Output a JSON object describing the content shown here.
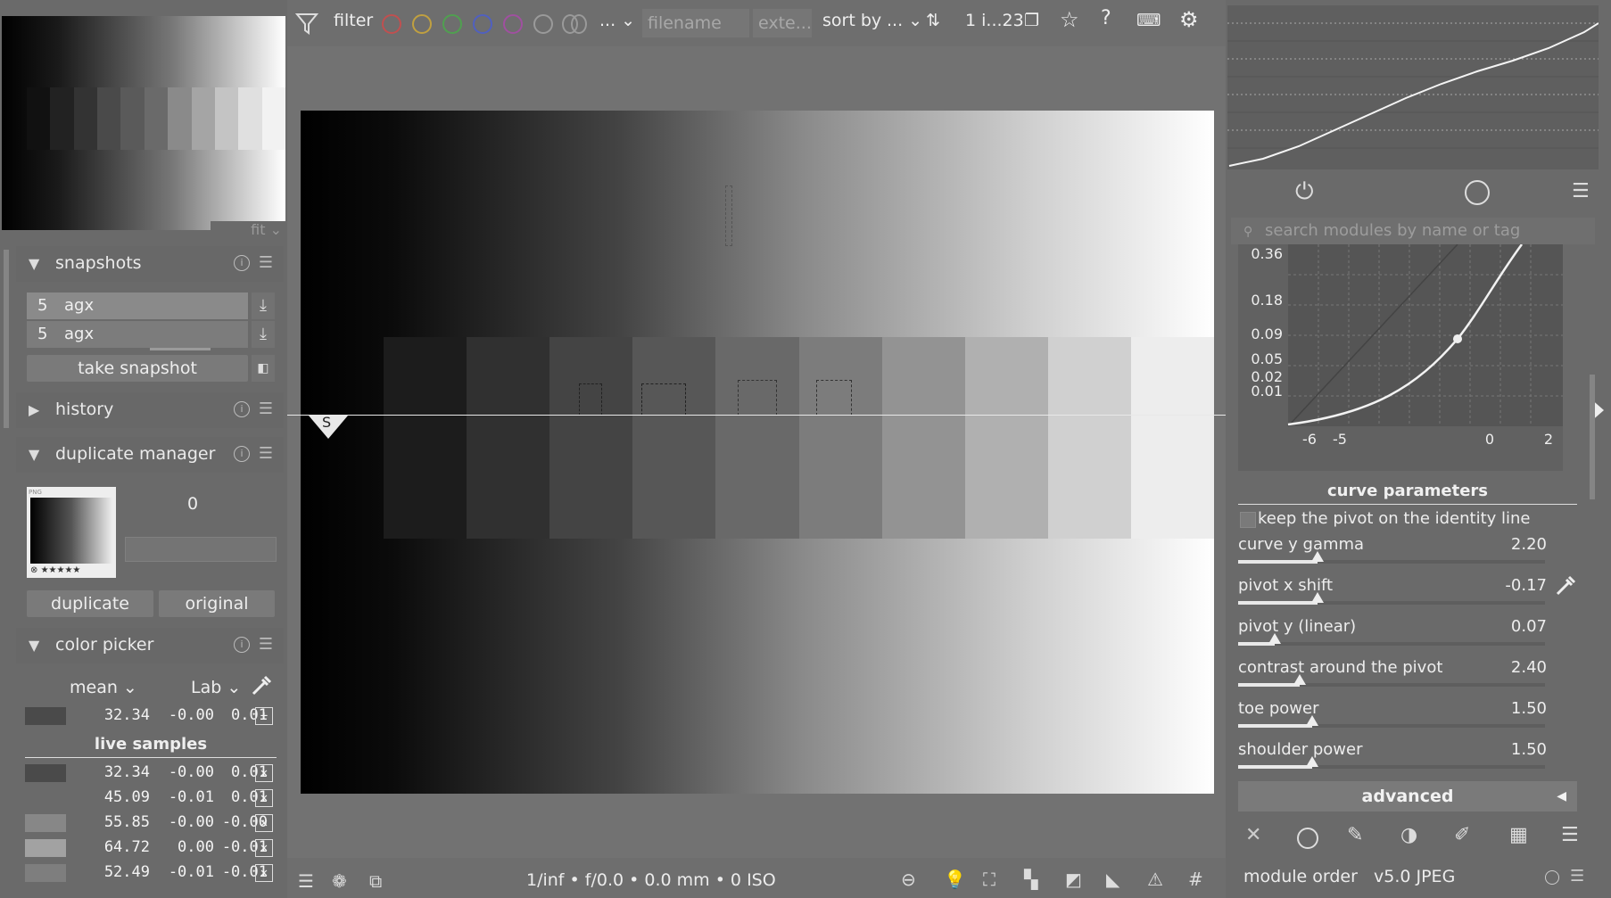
{
  "left": {
    "navigation": {
      "zoom_label": "fit"
    },
    "snapshots": {
      "title": "snapshots",
      "items": [
        {
          "number": "5",
          "label": "agx"
        },
        {
          "number": "5",
          "label": "agx"
        }
      ],
      "take_label": "take snapshot"
    },
    "history": {
      "title": "history"
    },
    "duplicate_manager": {
      "title": "duplicate manager",
      "count": "0",
      "thumb_badge": "PNG",
      "thumb_stars": "★★★★★",
      "duplicate_label": "duplicate",
      "original_label": "original"
    },
    "color_picker": {
      "title": "color picker",
      "mode": "mean",
      "space": "Lab",
      "main": {
        "v1": "32.34",
        "v2": "-0.00",
        "v3": "0.01",
        "color": "#4a4a4a"
      },
      "live_title": "live samples",
      "samples": [
        {
          "v1": "32.34",
          "v2": "-0.00",
          "v3": "0.01",
          "color": "#4a4a4a"
        },
        {
          "v1": "45.09",
          "v2": "-0.01",
          "v3": "0.01",
          "color": "#6a6a6a"
        },
        {
          "v1": "55.85",
          "v2": "-0.00",
          "v3": "-0.00",
          "color": "#878787"
        },
        {
          "v1": "64.72",
          "v2": "0.00",
          "v3": "-0.01",
          "color": "#a2a2a2"
        },
        {
          "v1": "52.49",
          "v2": "-0.01",
          "v3": "-0.01",
          "color": "#7e7e7e"
        }
      ]
    }
  },
  "topbar": {
    "filter_label": "filter",
    "dots": [
      "#c05050",
      "#c0a040",
      "#50a050",
      "#5060c0",
      "#a050a0",
      "#9a9a9a"
    ],
    "ellipsis": "...",
    "filename_placeholder": "filename",
    "ext_placeholder": "exte...",
    "sort_label": "sort by",
    "sort_value": "...",
    "count_label": "1 i...23"
  },
  "center": {
    "snapshot_marker": "S",
    "exif": "1/inf • f/0.0 • 0.0 mm • 0 ISO"
  },
  "right": {
    "search_placeholder": "search modules by name or tag",
    "curve": {
      "y_ticks": [
        "0.36",
        "0.18",
        "0.09",
        "0.05",
        "0.02",
        "0.01"
      ],
      "x_ticks": [
        "-6",
        "-5",
        "0",
        "2"
      ]
    },
    "params_title": "curve parameters",
    "keep_pivot_label": "keep the pivot on the identity line",
    "params": [
      {
        "label": "curve y gamma",
        "value": "2.20",
        "level": 0.26
      },
      {
        "label": "pivot x shift",
        "value": "-0.17",
        "level": 0.26
      },
      {
        "label": "pivot y (linear)",
        "value": "0.07",
        "level": 0.12
      },
      {
        "label": "contrast around the pivot",
        "value": "2.40",
        "level": 0.2
      },
      {
        "label": "toe power",
        "value": "1.50",
        "level": 0.24
      },
      {
        "label": "shoulder power",
        "value": "1.50",
        "level": 0.24
      }
    ],
    "advanced_label": "advanced",
    "module_order_label": "module order",
    "module_order_value": "v5.0 JPEG"
  }
}
